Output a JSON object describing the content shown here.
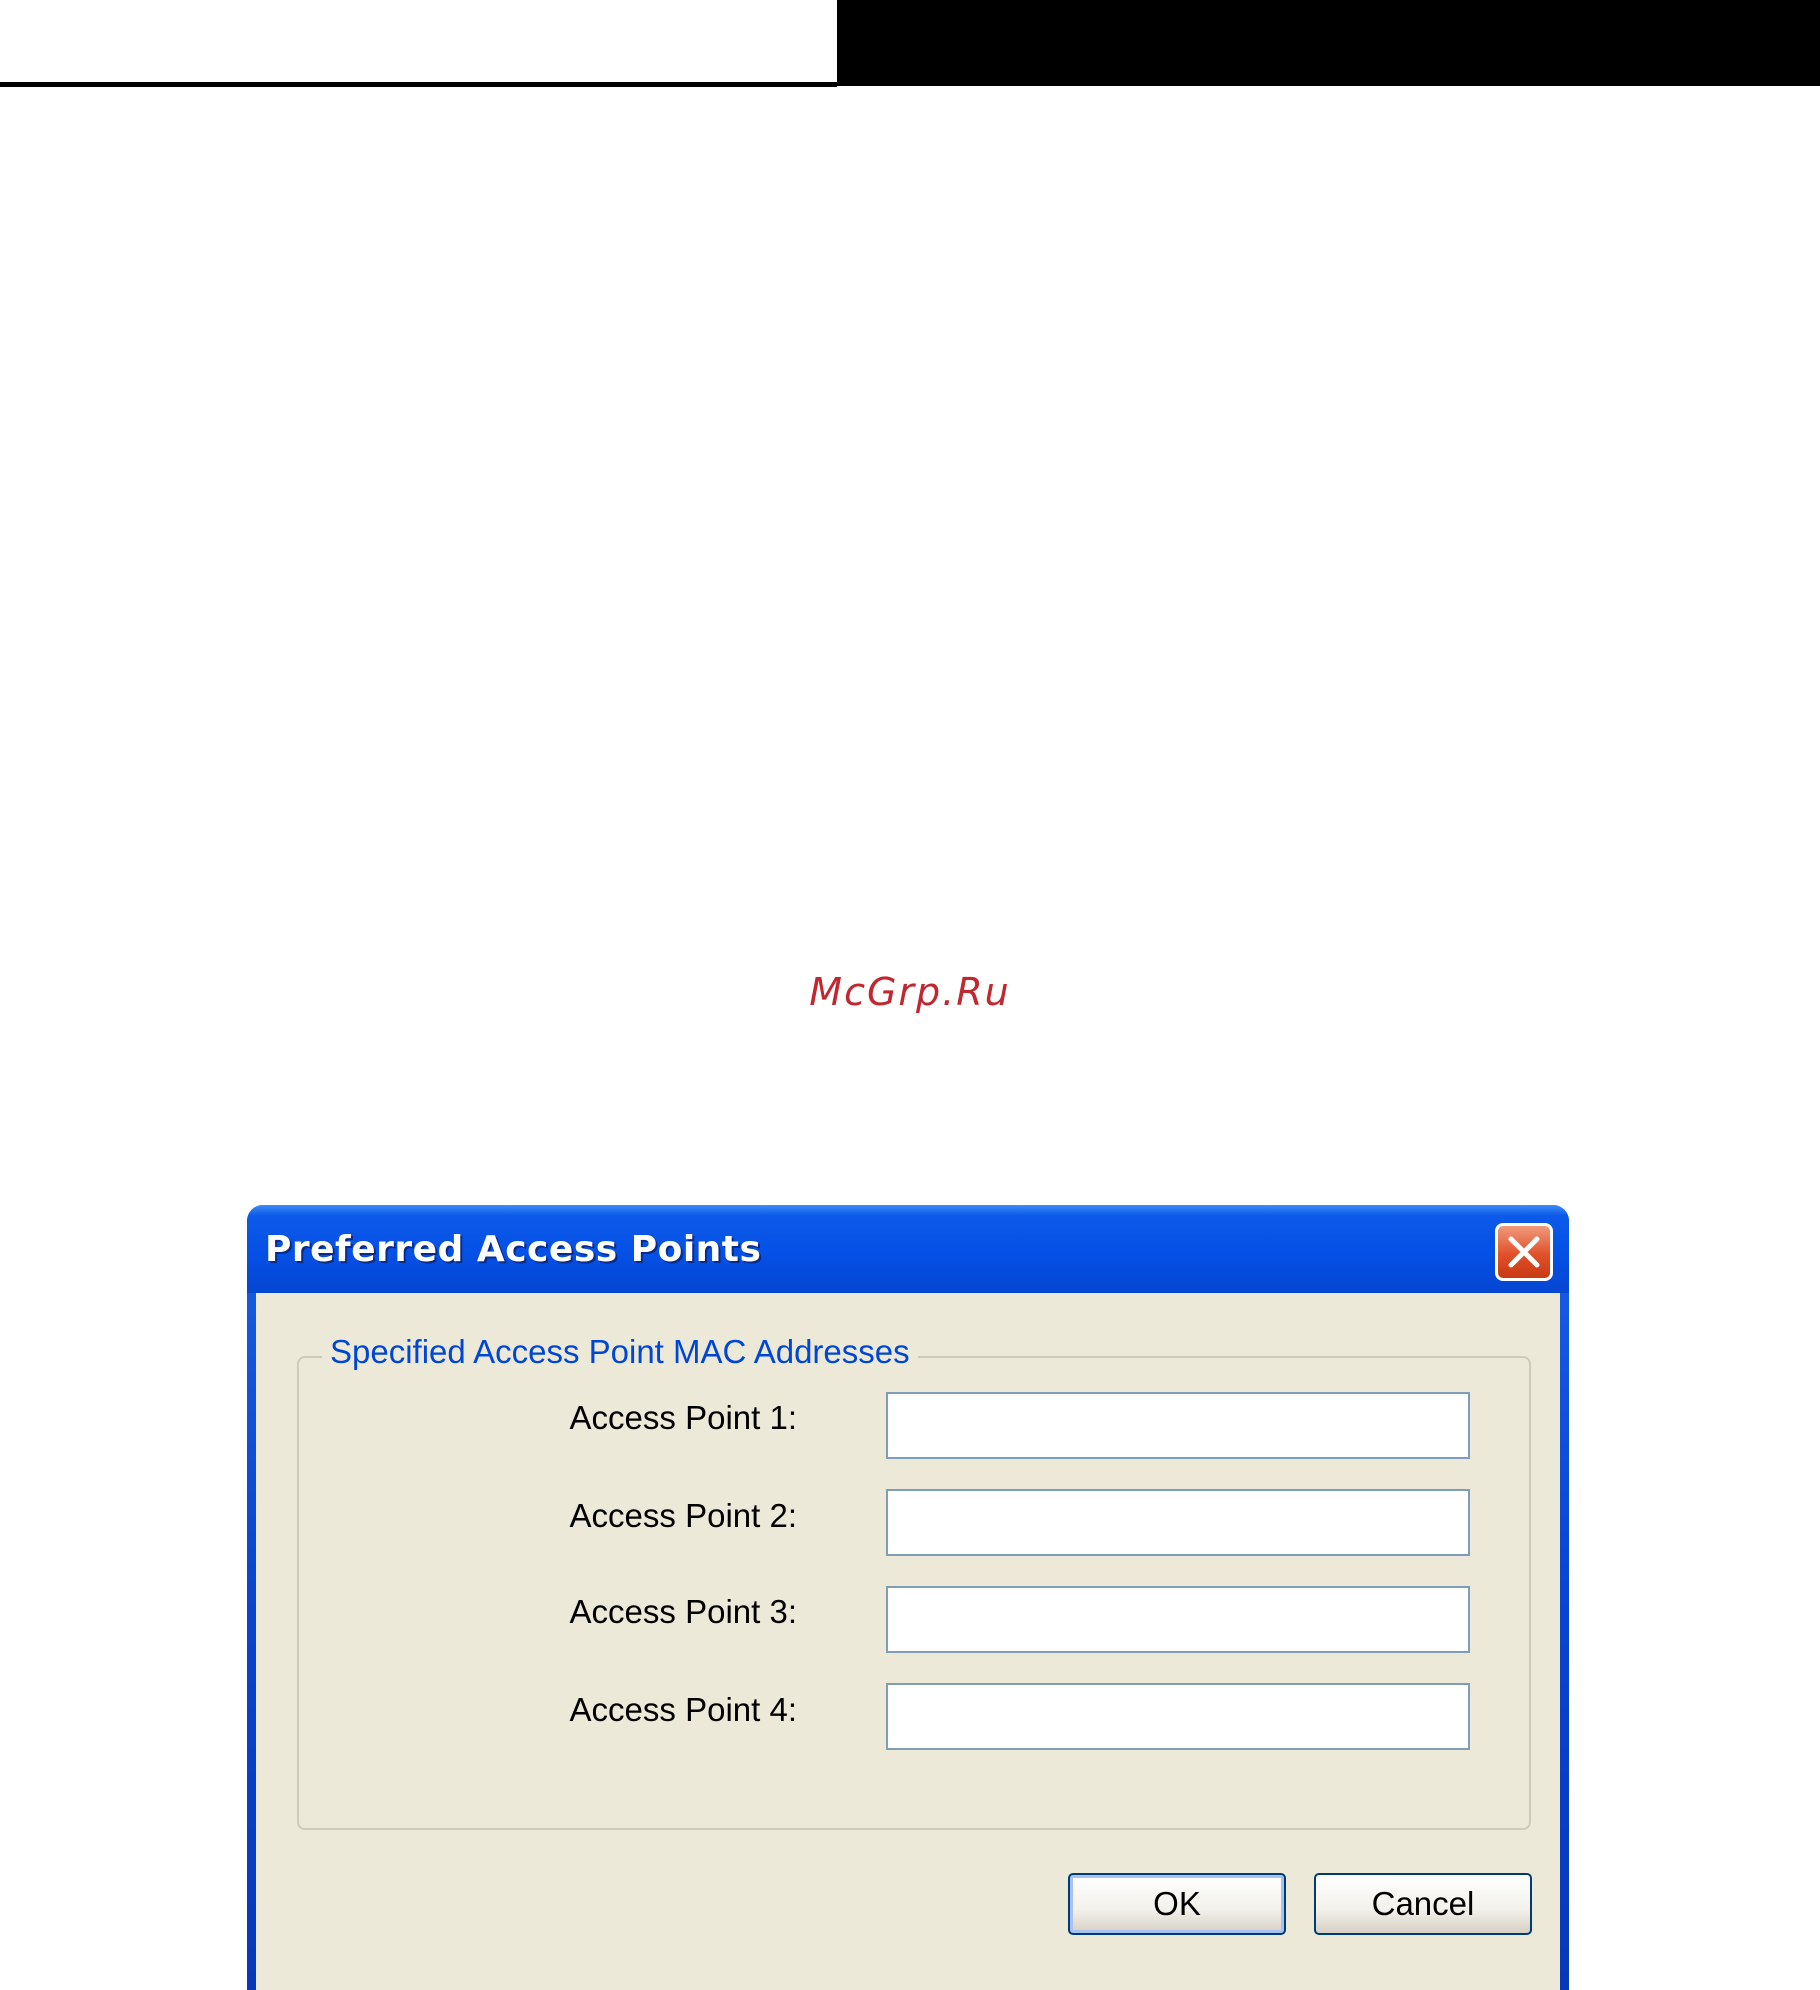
{
  "watermark": "McGrp.Ru",
  "dialog": {
    "title": "Preferred Access Points",
    "close_icon": "close-icon",
    "group_title": "Specified Access Point MAC Addresses",
    "fields": [
      {
        "label": "Access Point 1:",
        "value": ""
      },
      {
        "label": "Access Point 2:",
        "value": ""
      },
      {
        "label": "Access Point 3:",
        "value": ""
      },
      {
        "label": "Access Point 4:",
        "value": ""
      }
    ],
    "buttons": {
      "ok_label": "OK",
      "cancel_label": "Cancel"
    }
  },
  "colors": {
    "titlebar": "#0550e6",
    "client_bg": "#ece9d8",
    "group_title": "#0046d5",
    "close_button": "#e0512a",
    "watermark": "#c0282f"
  }
}
